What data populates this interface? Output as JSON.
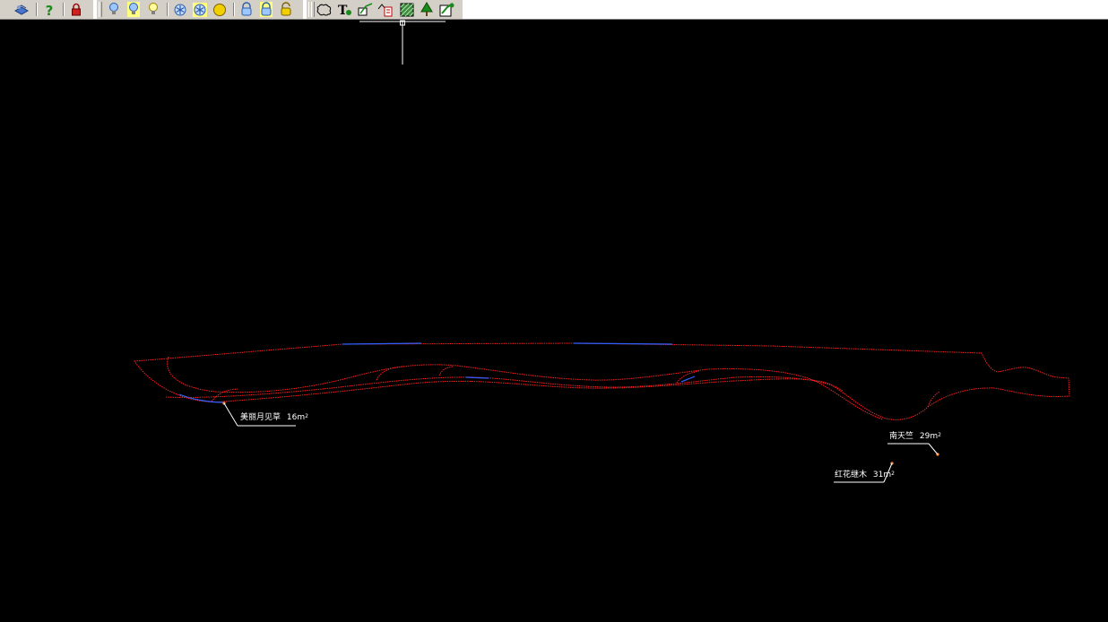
{
  "toolbar": {
    "tools": [
      {
        "name": "layer-manager-icon"
      },
      {
        "name": "help-icon"
      },
      {
        "name": "lock-icon"
      },
      {
        "name": "light-bulb-icon"
      },
      {
        "name": "light-bulb-yellow-icon"
      },
      {
        "name": "light-bulb-off-icon"
      },
      {
        "name": "snowflake-icon"
      },
      {
        "name": "freeze-icon"
      },
      {
        "name": "sun-icon"
      },
      {
        "name": "layer-lock-icon"
      },
      {
        "name": "layer-lock-yellow-icon"
      },
      {
        "name": "layer-unlock-icon"
      },
      {
        "name": "revision-cloud-icon"
      },
      {
        "name": "text-tool-icon"
      },
      {
        "name": "plant-edit-icon"
      },
      {
        "name": "plant-legend-icon"
      },
      {
        "name": "hatch-icon"
      },
      {
        "name": "tree-icon"
      },
      {
        "name": "landscape-icon"
      }
    ]
  },
  "labels": {
    "plant1_name": "美丽月见草",
    "plant1_area": "16m",
    "plant2_name": "南天竺",
    "plant2_area": "29m",
    "plant3_name": "红花继木",
    "plant3_area": "31m",
    "superscript": "2"
  },
  "colors": {
    "background": "#000000",
    "boundary": "#ff2020",
    "accent_line": "#3060ff",
    "leader": "#ffffff",
    "leader_dot": "#ff9040"
  }
}
